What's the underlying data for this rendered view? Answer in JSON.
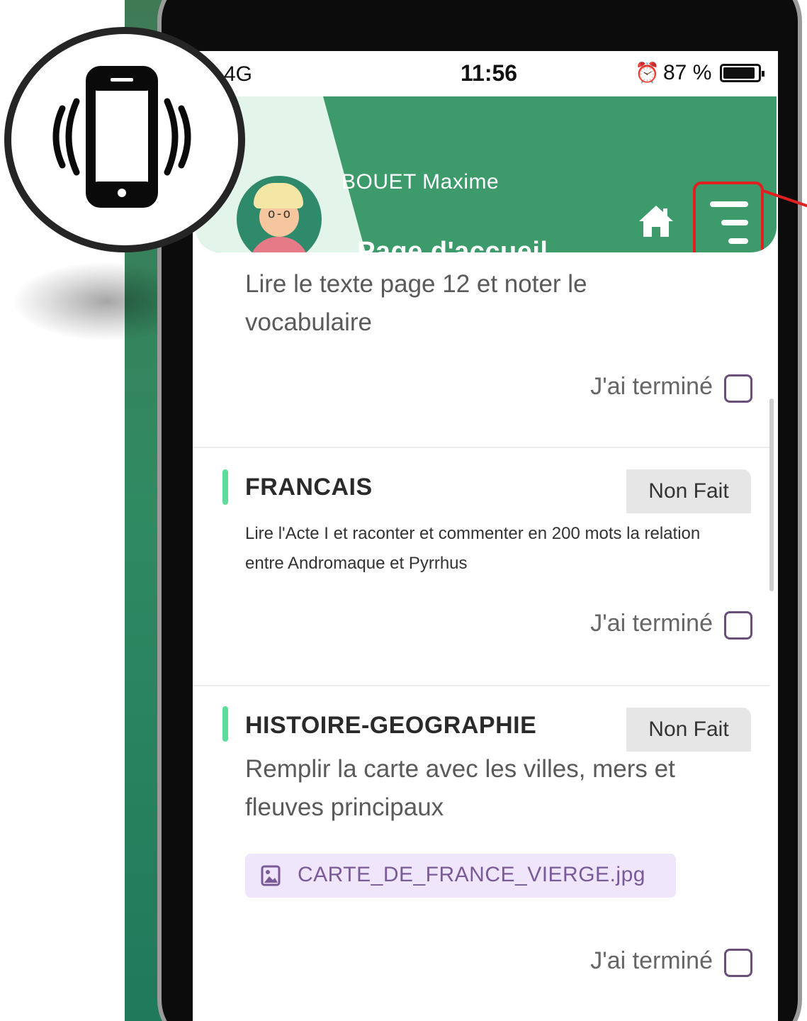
{
  "status_bar": {
    "network": "4G",
    "time": "11:56",
    "battery": "87 %"
  },
  "header": {
    "user_name": "BOUET Maxime",
    "page_title": "Page d'accueil"
  },
  "tasks": [
    {
      "description": "Lire le texte page 12 et noter le vocabulaire",
      "done_label": "J'ai terminé",
      "checked": false
    },
    {
      "subject": "FRANCAIS",
      "status": "Non Fait",
      "description": "Lire l'Acte I et raconter et commenter en 200 mots la relation entre Andromaque et Pyrrhus",
      "done_label": "J'ai terminé",
      "checked": false
    },
    {
      "subject": "HISTOIRE-GEOGRAPHIE",
      "status": "Non Fait",
      "description": "Remplir la carte avec les villes, mers et fleuves principaux",
      "attachment": "CARTE_DE_FRANCE_VIERGE.jpg",
      "done_label": "J'ai terminé",
      "checked": false
    }
  ],
  "colors": {
    "header_green": "#3d9a6a",
    "accent_green": "#5fdc9a",
    "highlight_red": "#e02020",
    "attachment_bg": "#f0e6fb"
  },
  "icons": [
    "vibrating-phone-icon",
    "home-icon",
    "menu-icon",
    "image-file-icon",
    "alarm-icon",
    "battery-icon"
  ]
}
